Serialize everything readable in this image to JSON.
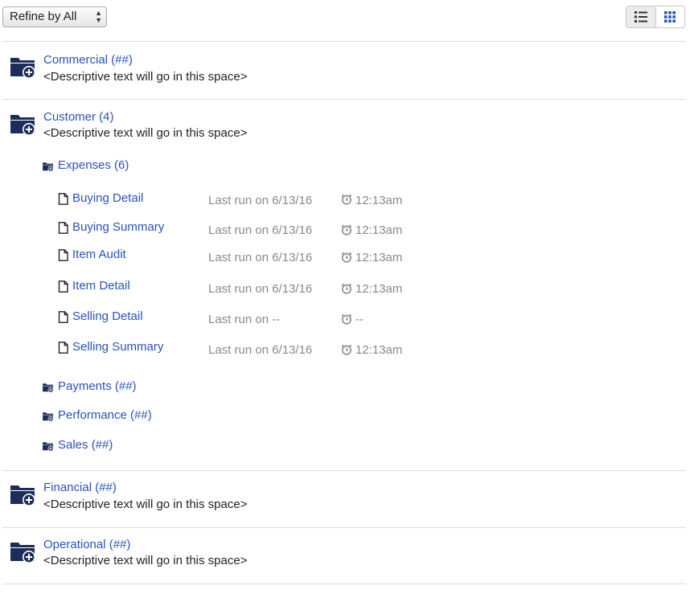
{
  "toolbar": {
    "refine_label": "Refine by All",
    "view_options": [
      {
        "name": "list-view",
        "icon": "list-icon",
        "selected": true
      },
      {
        "name": "grid-view",
        "icon": "grid-icon",
        "selected": false
      }
    ]
  },
  "colors": {
    "link": "#2a52be",
    "folder": "#1c2d59",
    "muted": "#8a8a8a",
    "divider": "#dcdcdc"
  },
  "categories": [
    {
      "title": "Commercial (##)",
      "description": "<Descriptive text will go in this space>",
      "icon": "folder-plus-icon"
    },
    {
      "title": "Customer (4)",
      "description": "<Descriptive text will go in this space>",
      "icon": "folder-plus-icon",
      "subfolders": [
        {
          "label": "Expenses (6)",
          "icon": "folder-plus-icon",
          "reports": [
            {
              "name": "Buying Detail",
              "last_run": "Last run on 6/13/16",
              "time": "12:13am",
              "icon": "document-icon"
            },
            {
              "name": "Buying Summary",
              "last_run": "Last run on 6/13/16",
              "time": "12:13am",
              "icon": "document-icon"
            },
            {
              "name": "Item Audit",
              "last_run": "Last run on 6/13/16",
              "time": "12:13am",
              "icon": "document-icon"
            },
            {
              "name": "Item Detail",
              "last_run": "Last run on 6/13/16",
              "time": "12:13am",
              "icon": "document-icon"
            },
            {
              "name": "Selling Detail",
              "last_run": "Last run on  --",
              "time": "--",
              "icon": "document-icon"
            },
            {
              "name": "Selling Summary",
              "last_run": "Last run on 6/13/16",
              "time": "12:13am",
              "icon": "document-icon"
            }
          ]
        },
        {
          "label": "Payments (##)",
          "icon": "folder-plus-icon"
        },
        {
          "label": "Performance (##)",
          "icon": "folder-plus-icon"
        },
        {
          "label": "Sales (##)",
          "icon": "folder-plus-icon"
        }
      ]
    },
    {
      "title": "Financial (##)",
      "description": "<Descriptive text will go in this space>",
      "icon": "folder-plus-icon"
    },
    {
      "title": "Operational (##)",
      "description": "<Descriptive text will go in this space>",
      "icon": "folder-plus-icon"
    }
  ]
}
